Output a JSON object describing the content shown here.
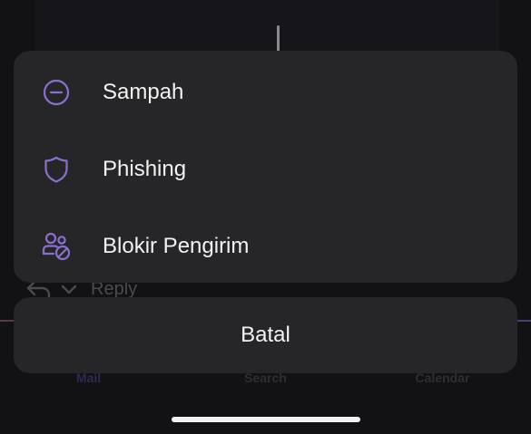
{
  "background": {
    "reply_label": "Reply",
    "tabs": [
      {
        "label": "Mail"
      },
      {
        "label": "Search"
      },
      {
        "label": "Calendar"
      }
    ]
  },
  "action_sheet": {
    "items": [
      {
        "label": "Sampah",
        "icon": "minus-circle-icon"
      },
      {
        "label": "Phishing",
        "icon": "shield-icon"
      },
      {
        "label": "Blokir Pengirim",
        "icon": "block-users-icon"
      }
    ],
    "cancel_label": "Batal"
  },
  "colors": {
    "sheet_background": "#262628",
    "icon_accent": "#8a6fd1",
    "text": "#f2f2f2",
    "screen_background": "#121214"
  }
}
